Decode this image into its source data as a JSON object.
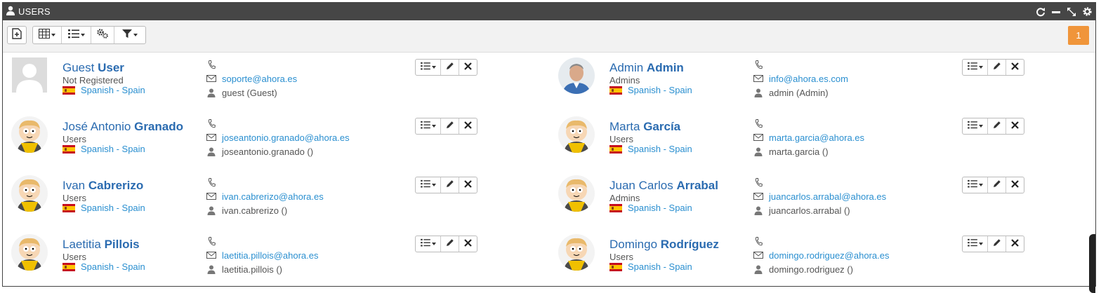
{
  "window": {
    "title": "USERS",
    "icons": [
      "user-icon",
      "refresh-icon",
      "minimize-icon",
      "expand-icon",
      "gear-icon"
    ]
  },
  "toolbar": {
    "page_badge": "1"
  },
  "users": [
    {
      "first": "Guest",
      "last": "User",
      "group": "Not Registered",
      "language": "Spanish - Spain",
      "phone": "",
      "email": "soporte@ahora.es",
      "login": "guest (Guest)",
      "avatar": "placeholder"
    },
    {
      "first": "Admin",
      "last": "Admin",
      "group": "Admins",
      "language": "Spanish - Spain",
      "phone": "",
      "email": "info@ahora.es.com",
      "login": "admin (Admin)",
      "avatar": "photo"
    },
    {
      "first": "José Antonio",
      "last": "Granado",
      "group": "Users",
      "language": "Spanish - Spain",
      "phone": "",
      "email": "joseantonio.granado@ahora.es",
      "login": "joseantonio.granado ()",
      "avatar": "cartoon"
    },
    {
      "first": "Marta",
      "last": "García",
      "group": "Users",
      "language": "Spanish - Spain",
      "phone": "",
      "email": "marta.garcia@ahora.es",
      "login": "marta.garcia ()",
      "avatar": "cartoon"
    },
    {
      "first": "Ivan",
      "last": "Cabrerizo",
      "group": "Users",
      "language": "Spanish - Spain",
      "phone": "",
      "email": "ivan.cabrerizo@ahora.es",
      "login": "ivan.cabrerizo ()",
      "avatar": "cartoon"
    },
    {
      "first": "Juan Carlos",
      "last": "Arrabal",
      "group": "Admins",
      "language": "Spanish - Spain",
      "phone": "",
      "email": "juancarlos.arrabal@ahora.es",
      "login": "juancarlos.arrabal ()",
      "avatar": "cartoon"
    },
    {
      "first": "Laetitia",
      "last": "Pillois",
      "group": "Users",
      "language": "Spanish - Spain",
      "phone": "",
      "email": "laetitia.pillois@ahora.es",
      "login": "laetitia.pillois ()",
      "avatar": "cartoon"
    },
    {
      "first": "Domingo",
      "last": "Rodríguez",
      "group": "Users",
      "language": "Spanish - Spain",
      "phone": "",
      "email": "domingo.rodriguez@ahora.es",
      "login": "domingo.rodriguez ()",
      "avatar": "cartoon"
    }
  ],
  "colors": {
    "link": "#2a6bb0",
    "badge": "#f0953a",
    "titlebar": "#464646"
  }
}
